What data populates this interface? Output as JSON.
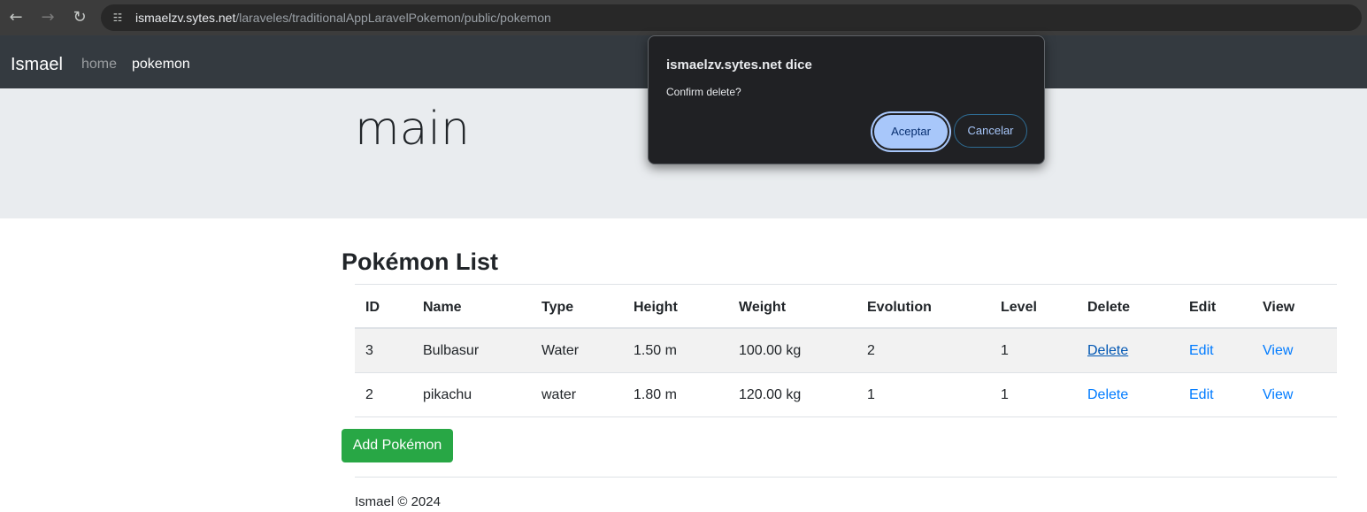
{
  "browser": {
    "back_icon": "arrow-left-icon",
    "forward_icon": "arrow-right-icon",
    "reload_icon": "reload-icon",
    "site_info_icon": "tune-icon",
    "url_host": "ismaelzv.sytes.net",
    "url_path": "/laraveles/traditionalAppLaravelPokemon/public/pokemon"
  },
  "navbar": {
    "brand": "Ismael",
    "links": [
      {
        "label": "home",
        "active": false
      },
      {
        "label": "pokemon",
        "active": true
      }
    ]
  },
  "jumbotron": {
    "title": "main"
  },
  "main": {
    "title": "Pokémon List",
    "columns": [
      "ID",
      "Name",
      "Type",
      "Height",
      "Weight",
      "Evolution",
      "Level",
      "Delete",
      "Edit",
      "View"
    ],
    "rows": [
      {
        "id": "3",
        "name": "Bulbasur",
        "type": "Water",
        "height": "1.50 m",
        "weight": "100.00 kg",
        "evolution": "2",
        "level": "1",
        "delete": "Delete",
        "edit": "Edit",
        "view": "View"
      },
      {
        "id": "2",
        "name": "pikachu",
        "type": "water",
        "height": "1.80 m",
        "weight": "120.00 kg",
        "evolution": "1",
        "level": "1",
        "delete": "Delete",
        "edit": "Edit",
        "view": "View"
      }
    ],
    "add_button": "Add Pokémon"
  },
  "footer": {
    "text": "Ismael © 2024"
  },
  "dialog": {
    "title": "ismaelzv.sytes.net dice",
    "message": "Confirm delete?",
    "accept": "Aceptar",
    "cancel": "Cancelar"
  },
  "colors": {
    "navbar": "#343a40",
    "jumbotron": "#e9ecef",
    "link": "#007bff",
    "success": "#28a745",
    "dialog_bg": "#202124",
    "dialog_accent": "#a8c7fa"
  }
}
